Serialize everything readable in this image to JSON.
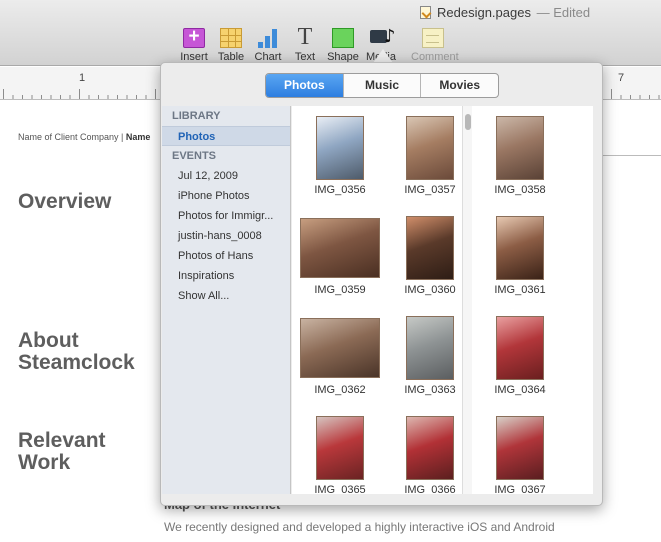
{
  "window": {
    "title": "Redesign.pages",
    "status": "— Edited"
  },
  "toolbar": {
    "tools": [
      {
        "label": "Insert",
        "icon": "insert-icon",
        "enabled": true
      },
      {
        "label": "Table",
        "icon": "table-icon",
        "enabled": true
      },
      {
        "label": "Chart",
        "icon": "chart-icon",
        "enabled": true
      },
      {
        "label": "Text",
        "icon": "text-icon",
        "enabled": true
      },
      {
        "label": "Shape",
        "icon": "shape-icon",
        "enabled": true
      },
      {
        "label": "Media",
        "icon": "media-icon",
        "enabled": true
      },
      {
        "label": "Comment",
        "icon": "comment-icon",
        "enabled": false
      }
    ]
  },
  "ruler": {
    "numbers": [
      "1",
      "7"
    ]
  },
  "document": {
    "client_line_prefix": "Name of Client Company |",
    "client_line_bold": "Name",
    "headings": [
      "Overview",
      "About Steamclock",
      "Relevant Work"
    ],
    "section_title": "Map of the Internet",
    "body_text": "We recently designed and developed a highly interactive iOS and Android"
  },
  "media_browser": {
    "tabs": [
      {
        "label": "Photos",
        "active": true
      },
      {
        "label": "Music",
        "active": false
      },
      {
        "label": "Movies",
        "active": false
      }
    ],
    "sidebar": {
      "library_header": "LIBRARY",
      "library_items": [
        {
          "label": "Photos",
          "selected": true
        }
      ],
      "events_header": "EVENTS",
      "event_items": [
        {
          "label": "Jul 12, 2009"
        },
        {
          "label": "iPhone Photos"
        },
        {
          "label": "Photos for Immigr..."
        },
        {
          "label": "justin-hans_0008"
        },
        {
          "label": "Photos of Hans"
        },
        {
          "label": "Inspirations"
        },
        {
          "label": "Show All..."
        }
      ]
    },
    "photos": [
      {
        "name": "IMG_0356",
        "colors": [
          "#4e5b6a",
          "#8fa6c2",
          "#e9eef5"
        ]
      },
      {
        "name": "IMG_0357",
        "colors": [
          "#6b4a3a",
          "#a57d62",
          "#d9c6b4"
        ]
      },
      {
        "name": "IMG_0358",
        "colors": [
          "#5a4236",
          "#9a7763",
          "#cbb7a8"
        ]
      },
      {
        "name": "IMG_0359",
        "colors": [
          "#4a2f22",
          "#7e5642",
          "#c79e80"
        ]
      },
      {
        "name": "IMG_0360",
        "colors": [
          "#2e1d15",
          "#5a3a2a",
          "#d08e6a"
        ]
      },
      {
        "name": "IMG_0361",
        "colors": [
          "#3a2217",
          "#8c5d45",
          "#e7c9b2"
        ]
      },
      {
        "name": "IMG_0362",
        "colors": [
          "#4a3428",
          "#8b6a55",
          "#c9b3a2"
        ]
      },
      {
        "name": "IMG_0363",
        "colors": [
          "#5b5e60",
          "#8e9394",
          "#c6c9c6"
        ]
      },
      {
        "name": "IMG_0364",
        "colors": [
          "#6a1f1f",
          "#b2363a",
          "#e9a0a0"
        ]
      },
      {
        "name": "IMG_0365",
        "colors": [
          "#6a2323",
          "#b9383b",
          "#d6c4c0"
        ]
      },
      {
        "name": "IMG_0366",
        "colors": [
          "#5b1f1f",
          "#b23136",
          "#ddb7b0"
        ]
      },
      {
        "name": "IMG_0367",
        "colors": [
          "#5a1e20",
          "#b0353a",
          "#d8d0c8"
        ]
      }
    ]
  }
}
